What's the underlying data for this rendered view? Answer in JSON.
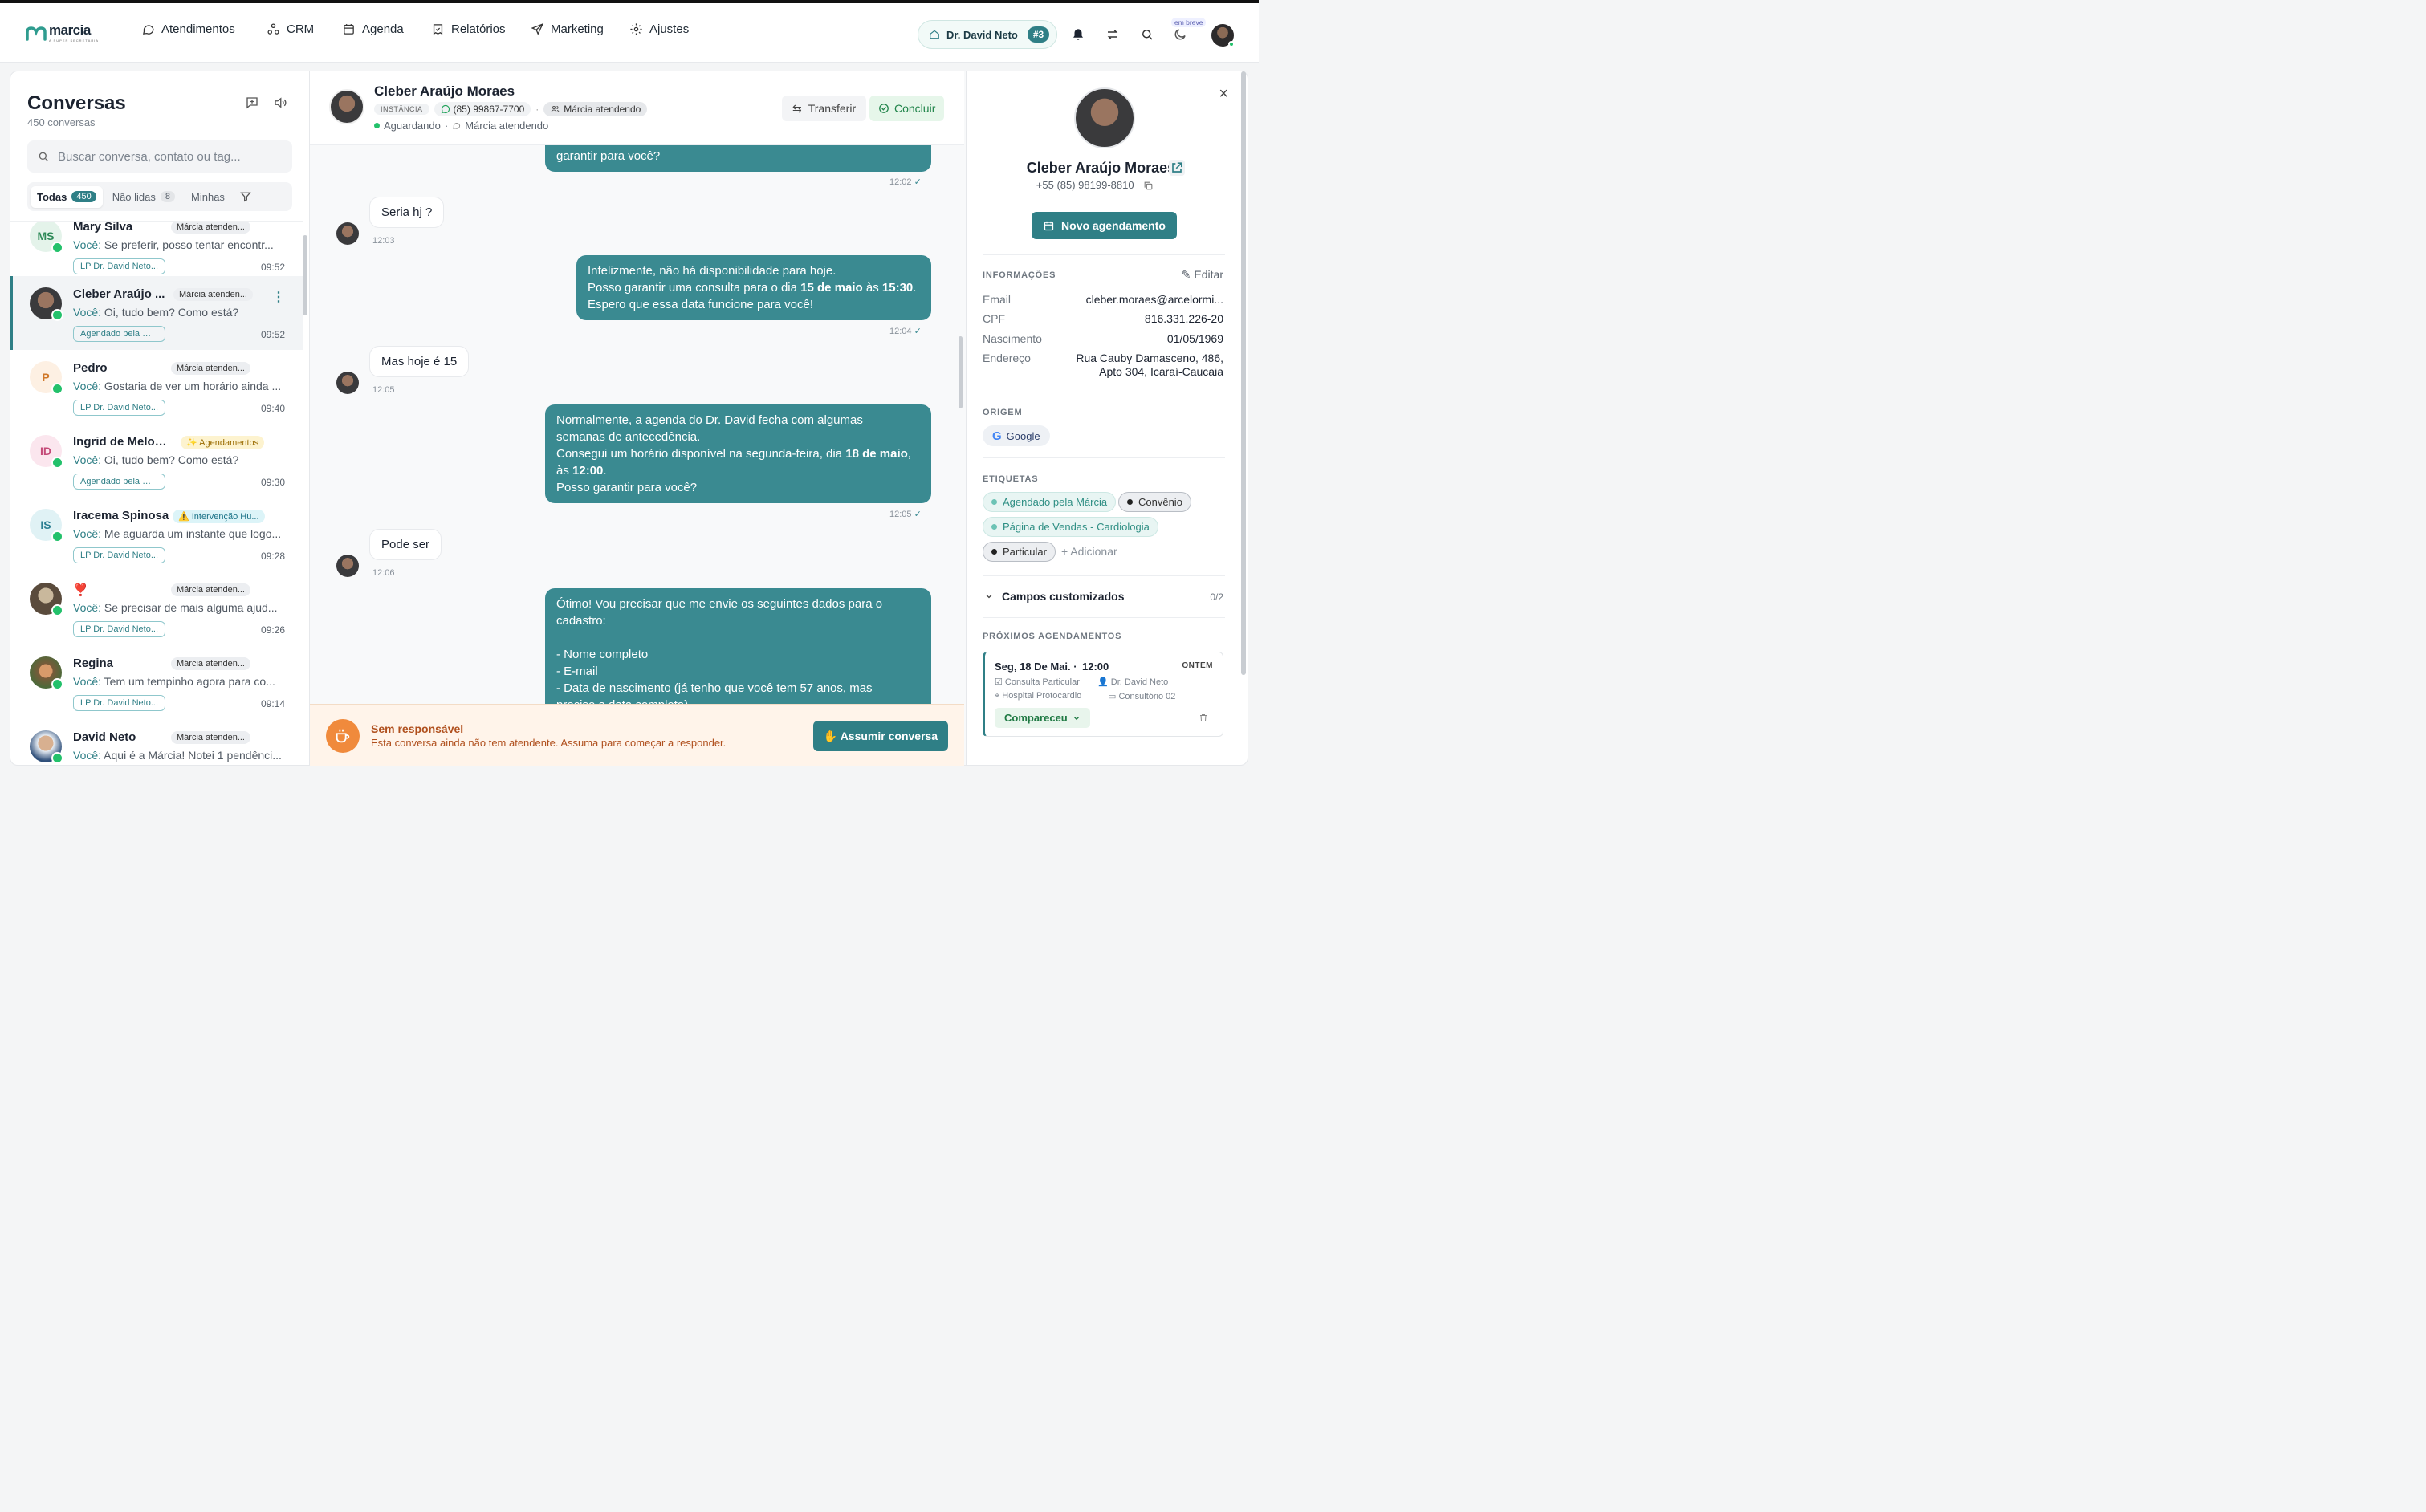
{
  "brand": {
    "logo_text": "marcia",
    "logo_sub": "A SUPER SECRETÁRIA"
  },
  "nav": [
    {
      "label": "Atendimentos",
      "icon": "chat-bubble-icon"
    },
    {
      "label": "CRM",
      "icon": "nodes-icon"
    },
    {
      "label": "Agenda",
      "icon": "calendar-icon"
    },
    {
      "label": "Relatórios",
      "icon": "report-icon"
    },
    {
      "label": "Marketing",
      "icon": "send-icon"
    },
    {
      "label": "Ajustes",
      "icon": "gear-icon"
    }
  ],
  "topbar": {
    "doctor": "Dr. David Neto",
    "doctor_num": "#3",
    "soon_label": "em breve"
  },
  "sidebar": {
    "title": "Conversas",
    "count": "450 conversas",
    "search_placeholder": "Buscar conversa, contato ou tag...",
    "tabs": [
      {
        "label": "Todas",
        "badge": "450"
      },
      {
        "label": "Não lidas",
        "badge": "8"
      },
      {
        "label": "Minhas",
        "badge": ""
      }
    ],
    "conversations": [
      {
        "initials": "MS",
        "name": "Mary Silva",
        "status": "Márcia atenden...",
        "prefix": "Você:",
        "message": "Se preferir, posso tentar encontr...",
        "tag": "LP Dr. David Neto...",
        "time": "09:52"
      },
      {
        "initials": "",
        "name": "Cleber Araújo ...",
        "status": "Márcia atenden...",
        "prefix": "Você:",
        "message": "Oi, tudo bem? Como está?",
        "tag": "Agendado pela Már...",
        "time": "09:52"
      },
      {
        "initials": "P",
        "name": "Pedro",
        "status": "Márcia atenden...",
        "prefix": "Você:",
        "message": "Gostaria de ver um horário ainda ...",
        "tag": "LP Dr. David Neto...",
        "time": "09:40"
      },
      {
        "initials": "ID",
        "name": "Ingrid de Melo F...",
        "status": "✨ Agendamentos",
        "prefix": "Você:",
        "message": "Oi, tudo bem? Como está?",
        "tag": "Agendado pela Már...",
        "time": "09:30"
      },
      {
        "initials": "IS",
        "name": "Iracema Spinosa",
        "status": "⚠️ Intervenção Hu...",
        "prefix": "Você:",
        "message": "Me aguarda um instante que logo...",
        "tag": "LP Dr. David Neto...",
        "time": "09:28"
      },
      {
        "initials": "",
        "name": "❣️",
        "status": "Márcia atenden...",
        "prefix": "Você:",
        "message": "Se precisar de mais alguma ajud...",
        "tag": "LP Dr. David Neto...",
        "time": "09:26"
      },
      {
        "initials": "",
        "name": "Regina",
        "status": "Márcia atenden...",
        "prefix": "Você:",
        "message": "Tem um tempinho agora para co...",
        "tag": "LP Dr. David Neto...",
        "time": "09:14"
      },
      {
        "initials": "",
        "name": "David Neto",
        "status": "Márcia atenden...",
        "prefix": "Você:",
        "message": "Aqui é a Márcia! Notei 1 pendênci...",
        "tag": "",
        "time": ""
      }
    ]
  },
  "chat": {
    "name": "Cleber Araújo Moraes",
    "instance_label": "INSTÂNCIA",
    "phone": "(85) 99867-7700",
    "attending": "Márcia atendendo",
    "state": "Aguardando",
    "state_sep": "·",
    "transfer_label": "Transferir",
    "conclude_label": "Concluir",
    "messages": {
      "m0": "garantir para você?",
      "m0_time": "12:02",
      "m1": "Seria hj ?",
      "m1_time": "12:03",
      "m2a": "Infelizmente, não há disponibilidade para hoje.",
      "m2b_pre": "Posso garantir uma consulta para o dia ",
      "m2b_b1": "15 de maio",
      "m2b_mid": " às ",
      "m2b_b2": "15:30",
      "m2b_post": ".",
      "m2c": "Espero que essa data funcione para você!",
      "m2_time": "12:04",
      "m3": "Mas hoje é 15",
      "m3_time": "12:05",
      "m4a": "Normalmente, a agenda do Dr. David fecha com algumas",
      "m4b": "semanas de antecedência.",
      "m4c_pre": "Consegui um horário disponível na segunda-feira, dia ",
      "m4c_b": "18 de maio",
      "m4c_post": ",",
      "m4d_pre": "às ",
      "m4d_b": "12:00",
      "m4d_post": ".",
      "m4e": "Posso garantir para você?",
      "m4_time": "12:05",
      "m5": "Pode ser",
      "m5_time": "12:06",
      "m6a": "Ótimo! Vou precisar que me envie os seguintes dados para o",
      "m6b": "cadastro:",
      "m6c": "- Nome completo",
      "m6d": "- E-mail",
      "m6e": "- Data de nascimento (já tenho que você tem 57 anos, mas",
      "m6f": "preciso a data completa)"
    },
    "warning_title": "Sem responsável",
    "warning_text": "Esta conversa ainda não tem atendente. Assuma para começar a responder.",
    "assume_label": "✋ Assumir conversa"
  },
  "contact": {
    "name": "Cleber Araújo Moraes",
    "phone": "+55 (85) 98199-8810",
    "new_appointment": "Novo agendamento",
    "info_header": "INFORMAÇÕES",
    "edit_label": "Editar",
    "fields": [
      {
        "k": "Email",
        "v": "cleber.moraes@arcelormi..."
      },
      {
        "k": "CPF",
        "v": "816.331.226-20"
      },
      {
        "k": "Nascimento",
        "v": "01/05/1969"
      },
      {
        "k": "Endereço",
        "v": "Rua Cauby Damasceno, 486,",
        "v2": "Apto 304, Icaraí-Caucaia"
      }
    ],
    "origin_header": "ORIGEM",
    "origin": "Google",
    "tags_header": "ETIQUETAS",
    "tags": [
      "Agendado pela Márcia",
      "Convênio",
      "Página de Vendas - Cardiologia",
      "Particular"
    ],
    "add_tag": "+ Adicionar",
    "custom_fields": "Campos customizados",
    "custom_count": "0/2",
    "upcoming_header": "PRÓXIMOS AGENDAMENTOS",
    "appointment": {
      "date": "Seg, 18 De Mai.",
      "time": "12:00",
      "when": "ONTEM",
      "type": "Consulta Particular",
      "doctor": "Dr. David Neto",
      "place": "Hospital Protocardio",
      "room": "Consultório 02",
      "status": "Compareceu"
    }
  },
  "colors": {
    "accent": "#2f7f86",
    "whatsapp": "#23c16b",
    "warning": "#f08a3c"
  }
}
